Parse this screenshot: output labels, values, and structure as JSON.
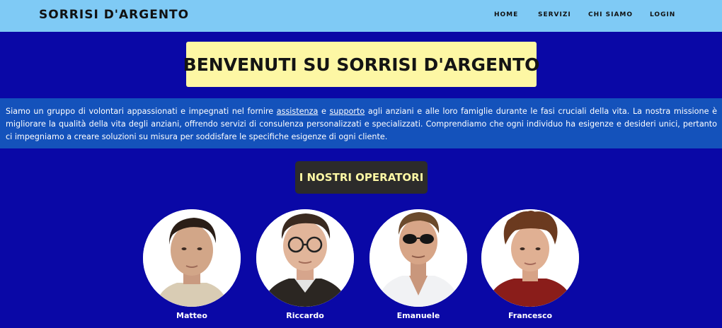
{
  "nav": {
    "brand": "SORRISI D'ARGENTO",
    "links": [
      "HOME",
      "SERVIZI",
      "CHI SIAMO",
      "LOGIN"
    ]
  },
  "hero": {
    "title": "BENVENUTI SU SORRISI D'ARGENTO"
  },
  "intro": {
    "part1": "Siamo un gruppo di volontari appassionati e impegnati nel fornire ",
    "link1": "assistenza",
    "part2": " e ",
    "link2": "supporto",
    "part3": " agli anziani e alle loro famiglie durante le fasi cruciali della vita. La nostra missione è migliorare la qualità della vita degli anziani, offrendo servizi di consulenza personalizzati e specializzati. Comprendiamo che ogni individuo ha esigenze e desideri unici, pertanto ci impegniamo a creare soluzioni su misura per soddisfare le specifiche esigenze di ogni cliente."
  },
  "operators": {
    "title": "I NOSTRI OPERATORI",
    "people": [
      {
        "name": "Matteo"
      },
      {
        "name": "Riccardo"
      },
      {
        "name": "Emanuele"
      },
      {
        "name": "Francesco"
      }
    ]
  },
  "colors": {
    "background": "#0a08a6",
    "navbar": "#7fcaf5",
    "hero_box": "#fdf7a4",
    "intro_band": "#1452bb",
    "operators_box": "#2c2b2b"
  }
}
